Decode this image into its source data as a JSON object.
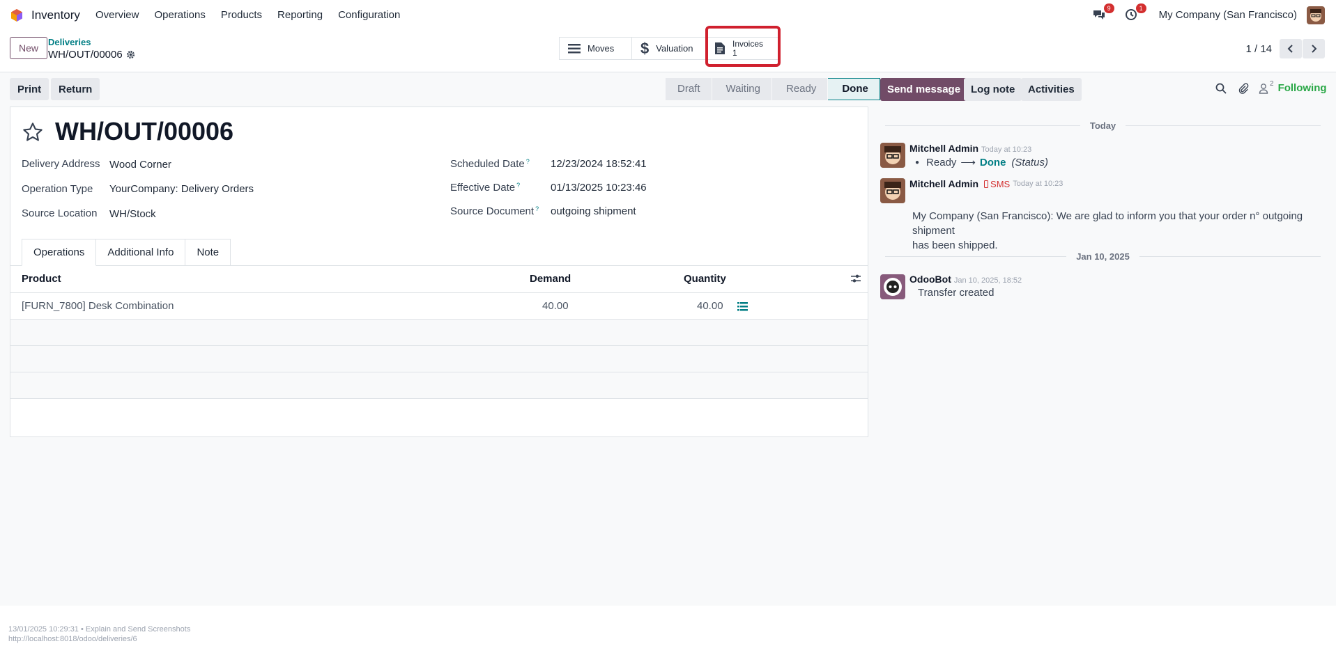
{
  "nav": {
    "app_name": "Inventory",
    "menu": [
      "Overview",
      "Operations",
      "Products",
      "Reporting",
      "Configuration"
    ],
    "messages_count": "9",
    "activities_count": "1",
    "company": "My Company (San Francisco)"
  },
  "control": {
    "new_label": "New",
    "breadcrumb": "Deliveries",
    "record_name": "WH/OUT/00006",
    "moves_label": "Moves",
    "valuation_label": "Valuation",
    "invoices_label": "Invoices",
    "invoices_count": "1",
    "pager": "1 / 14"
  },
  "actions": {
    "print": "Print",
    "return": "Return"
  },
  "status": {
    "stages": [
      "Draft",
      "Waiting",
      "Ready",
      "Done"
    ],
    "active": "Done"
  },
  "form": {
    "title": "WH/OUT/00006",
    "delivery_address_label": "Delivery Address",
    "delivery_address": "Wood Corner",
    "operation_type_label": "Operation Type",
    "operation_type": "YourCompany: Delivery Orders",
    "source_location_label": "Source Location",
    "source_location": "WH/Stock",
    "scheduled_date_label": "Scheduled Date",
    "scheduled_date": "12/23/2024 18:52:41",
    "effective_date_label": "Effective Date",
    "effective_date": "01/13/2025 10:23:46",
    "source_document_label": "Source Document",
    "source_document": "outgoing shipment",
    "help_mark": "?"
  },
  "tabs": [
    "Operations",
    "Additional Info",
    "Note"
  ],
  "table": {
    "headers": {
      "product": "Product",
      "demand": "Demand",
      "quantity": "Quantity"
    },
    "rows": [
      {
        "product": "[FURN_7800] Desk Combination",
        "demand": "40.00",
        "quantity": "40.00"
      }
    ]
  },
  "chatter": {
    "send_message": "Send message",
    "log_note": "Log note",
    "activities": "Activities",
    "followers_count": "2",
    "following": "Following",
    "today_label": "Today",
    "msg1": {
      "author": "Mitchell Admin",
      "time": "Today at 10:23",
      "from_state": "Ready",
      "arrow": "⟶",
      "to_state": "Done",
      "field": "(Status)"
    },
    "msg2": {
      "author": "Mitchell Admin",
      "tag": "SMS",
      "time": "Today at 10:23",
      "body_line1": "My Company (San Francisco): We are glad to inform you that your order n° outgoing shipment",
      "body_line2": "has been shipped."
    },
    "date2_label": "Jan 10, 2025",
    "msg3": {
      "author": "OdooBot",
      "time": "Jan 10, 2025, 18:52",
      "body": "Transfer created"
    }
  },
  "footer": {
    "line1": "13/01/2025 10:29:31 • Explain and Send Screenshots",
    "line2": "http://localhost:8018/odoo/deliveries/6"
  },
  "colors": {
    "brand": "#714b67",
    "accent": "#017e84",
    "highlight": "#d0202e",
    "badge": "#d32f2f"
  }
}
